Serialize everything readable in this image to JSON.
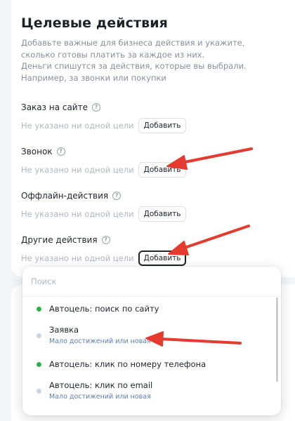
{
  "title": "Целевые действия",
  "description": {
    "line1": "Добавьте важные для бизнеса действия и укажите, сколько готовы платить за каждое из них.",
    "line2": "Деньги спишутся за действия, которые вы выбрали. Например, за звонки или покупки"
  },
  "sections": [
    {
      "title": "Заказ на сайте",
      "empty": "Не указано ни одной цели",
      "button": "Добавить",
      "help": "?"
    },
    {
      "title": "Звонок",
      "empty": "Не указано ни одной цели",
      "button": "Добавить",
      "help": "?"
    },
    {
      "title": "Оффлайн-действия",
      "empty": "Не указано ни одной цели",
      "button": "Добавить",
      "help": "?"
    },
    {
      "title": "Другие действия",
      "empty": "Не указано ни одной цели",
      "button": "Добавить",
      "help": "?"
    }
  ],
  "dropdown": {
    "search_placeholder": "Поиск",
    "options": [
      {
        "label": "Автоцель: поиск по сайту",
        "sub": "",
        "status": "active"
      },
      {
        "label": "Заявка",
        "sub": "Мало достижений или новая",
        "status": "inactive"
      },
      {
        "label": "Автоцель: клик по номеру телефона",
        "sub": "",
        "status": "active"
      },
      {
        "label": "Автоцель: клик по email",
        "sub": "Мало достижений или новая",
        "status": "inactive"
      }
    ]
  },
  "colors": {
    "active_dot": "#2fb04a",
    "inactive_dot": "#cfd3d8",
    "annotation_arrow": "#e53a2f"
  }
}
